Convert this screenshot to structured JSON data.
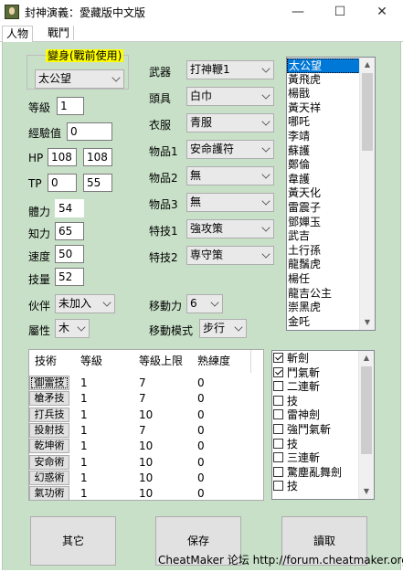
{
  "window": {
    "title": "封神演義：愛藏版中文版",
    "minimize": "—",
    "maximize": "☐",
    "close": "✕"
  },
  "tabs": [
    "人物",
    "戰鬥"
  ],
  "transform": {
    "group_title": "變身(戰前使用)",
    "value": "太公望"
  },
  "stats": {
    "level_label": "等級",
    "level": "1",
    "exp_label": "經驗值",
    "exp": "0",
    "hp_label": "HP",
    "hp_cur": "108",
    "hp_max": "108",
    "tp_label": "TP",
    "tp_cur": "0",
    "tp_max": "55",
    "str_label": "體力",
    "str": "54",
    "int_label": "知力",
    "int": "65",
    "spd_label": "速度",
    "spd": "50",
    "skl_label": "技量",
    "skl": "52",
    "partner_label": "伙伴",
    "partner": "未加入",
    "attr_label": "屬性",
    "attr": "木"
  },
  "equipment": {
    "weapon_label": "武器",
    "weapon": "打神鞭1",
    "head_label": "頭具",
    "head": "白巾",
    "clothes_label": "衣服",
    "clothes": "青服",
    "item1_label": "物品1",
    "item1": "安命護符",
    "item2_label": "物品2",
    "item2": "無",
    "item3_label": "物品3",
    "item3": "無",
    "skill1_label": "特技1",
    "skill1": "強攻策",
    "skill2_label": "特技2",
    "skill2": "専守策",
    "move_label": "移動力",
    "move": "6",
    "movemode_label": "移動模式",
    "movemode": "步行"
  },
  "characters": [
    "太公望",
    "黃飛虎",
    "楊戩",
    "黃天祥",
    "哪吒",
    "李靖",
    "蘇護",
    "鄭倫",
    "韋護",
    "黃天化",
    "雷震子",
    "鄧嬋玉",
    "武吉",
    "土行孫",
    "龍鬚虎",
    "楊任",
    "龍吉公主",
    "崇黑虎",
    "金吒"
  ],
  "skills_table": {
    "headers": [
      "技術",
      "等級",
      "等級上限",
      "熟練度"
    ],
    "rows": [
      {
        "name": "御雷技",
        "level": "1",
        "max": "7",
        "prof": "0"
      },
      {
        "name": "槍矛技",
        "level": "1",
        "max": "7",
        "prof": "0"
      },
      {
        "name": "打兵技",
        "level": "1",
        "max": "10",
        "prof": "0"
      },
      {
        "name": "投射技",
        "level": "1",
        "max": "7",
        "prof": "0"
      },
      {
        "name": "乾坤術",
        "level": "1",
        "max": "10",
        "prof": "0"
      },
      {
        "name": "安命術",
        "level": "1",
        "max": "10",
        "prof": "0"
      },
      {
        "name": "幻惑術",
        "level": "1",
        "max": "10",
        "prof": "0"
      },
      {
        "name": "氣功術",
        "level": "1",
        "max": "10",
        "prof": "0"
      }
    ]
  },
  "techniques": [
    {
      "label": "斬劍",
      "checked": true
    },
    {
      "label": "鬥氣斬",
      "checked": true
    },
    {
      "label": "二連斬",
      "checked": false
    },
    {
      "label": "技",
      "checked": false
    },
    {
      "label": "雷神劍",
      "checked": false
    },
    {
      "label": "強鬥氣斬",
      "checked": false
    },
    {
      "label": "技",
      "checked": false
    },
    {
      "label": "三連斬",
      "checked": false
    },
    {
      "label": "驚塵亂舞劍",
      "checked": false
    },
    {
      "label": "技",
      "checked": false
    }
  ],
  "buttons": {
    "other": "其它",
    "save": "保存",
    "load": "讀取"
  },
  "footer": "CheatMaker 论坛 http://forum.cheatmaker.org/"
}
